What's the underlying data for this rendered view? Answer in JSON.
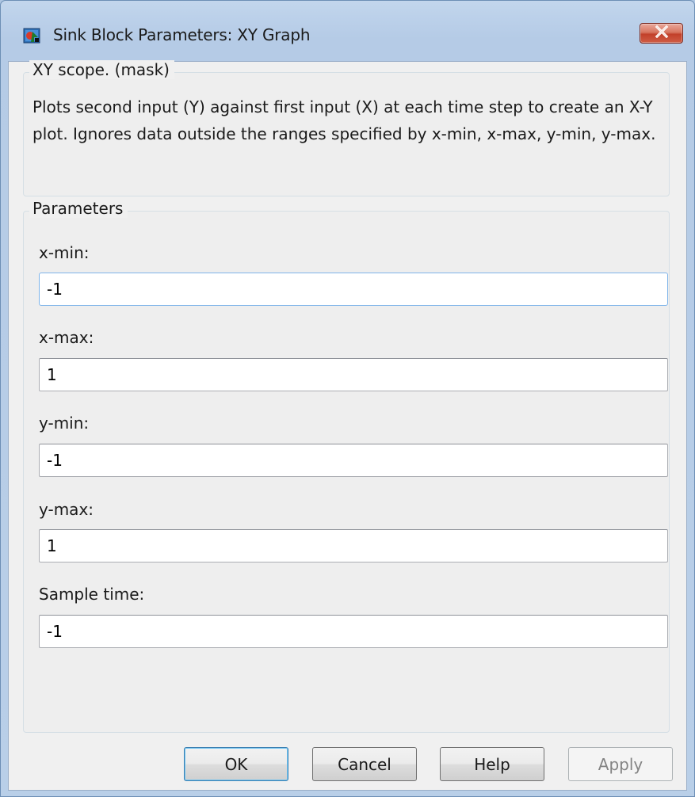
{
  "window": {
    "title": "Sink Block Parameters: XY Graph",
    "close_icon": "close-icon",
    "app_icon": "simulink-block-icon"
  },
  "mask_section": {
    "legend": "XY scope. (mask)",
    "description": "Plots second input (Y) against first input (X) at each time step to create an X-Y plot. Ignores data outside the ranges specified by x-min, x-max, y-min, y-max."
  },
  "parameters": {
    "legend": "Parameters",
    "fields": [
      {
        "label": "x-min:",
        "value": "-1"
      },
      {
        "label": "x-max:",
        "value": "1"
      },
      {
        "label": "y-min:",
        "value": "-1"
      },
      {
        "label": "y-max:",
        "value": "1"
      },
      {
        "label": "Sample time:",
        "value": "-1"
      }
    ]
  },
  "buttons": {
    "ok": "OK",
    "cancel": "Cancel",
    "help": "Help",
    "apply": "Apply"
  },
  "colors": {
    "accent": "#3c7fb1",
    "close_button": "#c2402a"
  }
}
